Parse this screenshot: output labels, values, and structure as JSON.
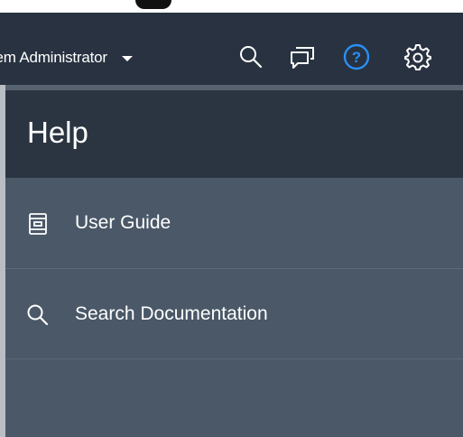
{
  "header": {
    "user_name": "tem Administrator",
    "icons": [
      "search-icon",
      "chat-icon",
      "help-icon",
      "gear-icon"
    ],
    "help_icon_color": "#2a8ff7"
  },
  "help_panel": {
    "title": "Help",
    "items": [
      {
        "label": "User Guide",
        "icon": "book-icon"
      },
      {
        "label": "Search Documentation",
        "icon": "search-icon"
      }
    ]
  },
  "colors": {
    "header_bg": "#283240",
    "panel_header_bg": "#2b3542",
    "panel_bg": "#4a5868",
    "text": "#ffffff"
  }
}
